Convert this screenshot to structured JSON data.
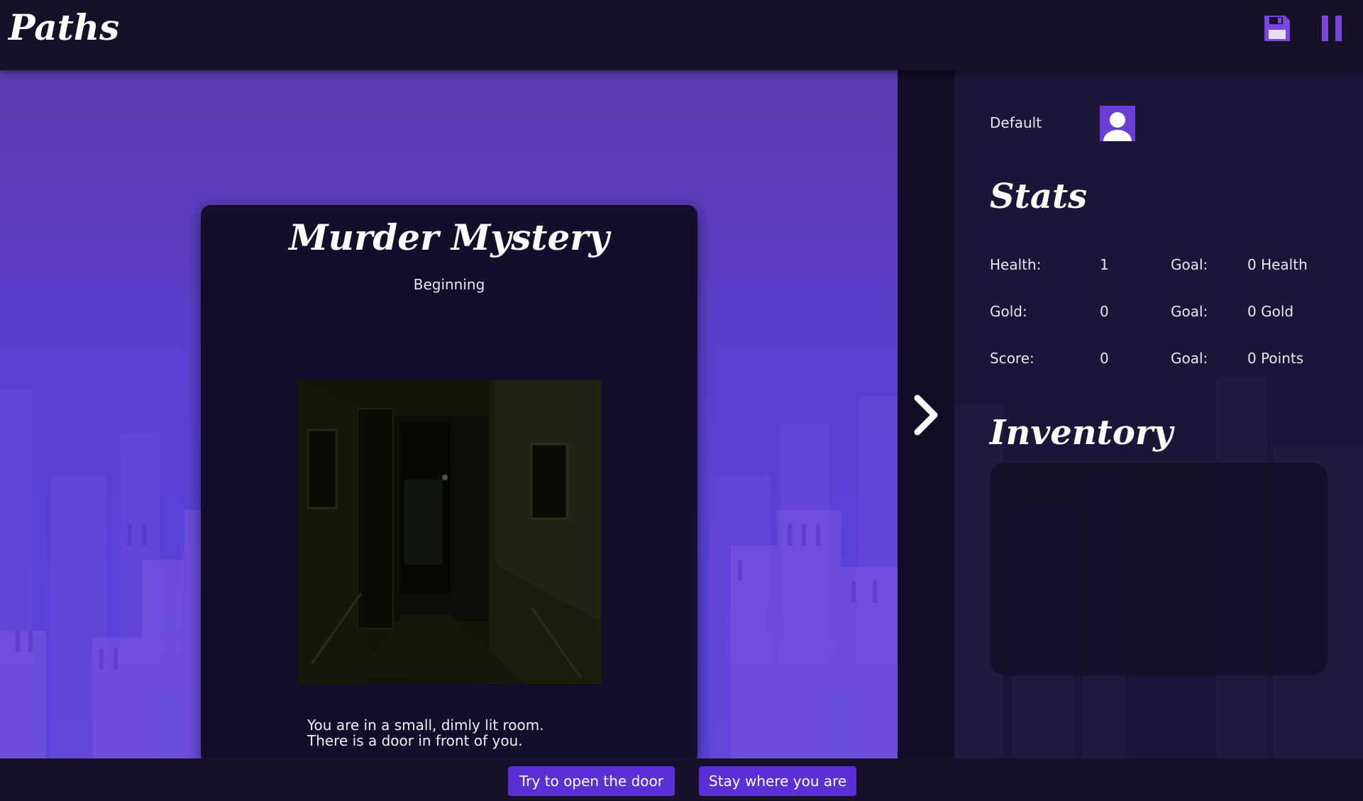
{
  "app": {
    "title": "Paths"
  },
  "header": {
    "save_icon": "floppy-disk-icon",
    "pause_icon": "pause-icon"
  },
  "story": {
    "title": "Murder Mystery",
    "passage": "Beginning",
    "text_line1": "You are in a small, dimly lit room.",
    "text_line2": "There is a door in front of you."
  },
  "player": {
    "name": "Default",
    "avatar_icon": "user-avatar-icon"
  },
  "stats": {
    "title": "Stats",
    "rows": [
      {
        "label": "Health:",
        "value": "1",
        "goal_label": "Goal:",
        "goal_value": "0 Health"
      },
      {
        "label": "Gold:",
        "value": "0",
        "goal_label": "Goal:",
        "goal_value": "0 Gold"
      },
      {
        "label": "Score:",
        "value": "0",
        "goal_label": "Goal:",
        "goal_value": "0 Points"
      }
    ]
  },
  "inventory": {
    "title": "Inventory",
    "items": []
  },
  "navigation": {
    "next_icon": "chevron-right-icon"
  },
  "choices": [
    {
      "label": "Try to open the door"
    },
    {
      "label": "Stay where you are"
    }
  ],
  "colors": {
    "accent": "#5a30d6",
    "header_bg": "#161028",
    "card_bg": "#140e2a",
    "icon_purple": "#7b45e0"
  }
}
